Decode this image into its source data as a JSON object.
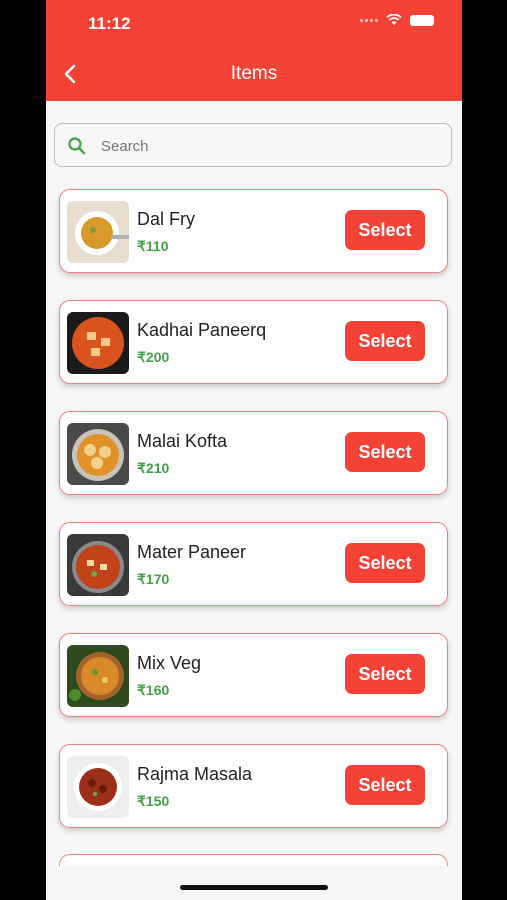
{
  "status_bar": {
    "time": "11:12"
  },
  "header": {
    "title": "Items"
  },
  "search": {
    "placeholder": "Search",
    "value": ""
  },
  "items": [
    {
      "name": "Dal Fry",
      "price": "₹110",
      "button": "Select"
    },
    {
      "name": "Kadhai Paneerq",
      "price": "₹200",
      "button": "Select"
    },
    {
      "name": "Malai Kofta",
      "price": "₹210",
      "button": "Select"
    },
    {
      "name": "Mater Paneer",
      "price": "₹170",
      "button": "Select"
    },
    {
      "name": "Mix Veg",
      "price": "₹160",
      "button": "Select"
    },
    {
      "name": "Rajma Masala",
      "price": "₹150",
      "button": "Select"
    }
  ],
  "colors": {
    "accent": "#f44336",
    "price": "#43a047",
    "card_border": "#f08080"
  }
}
